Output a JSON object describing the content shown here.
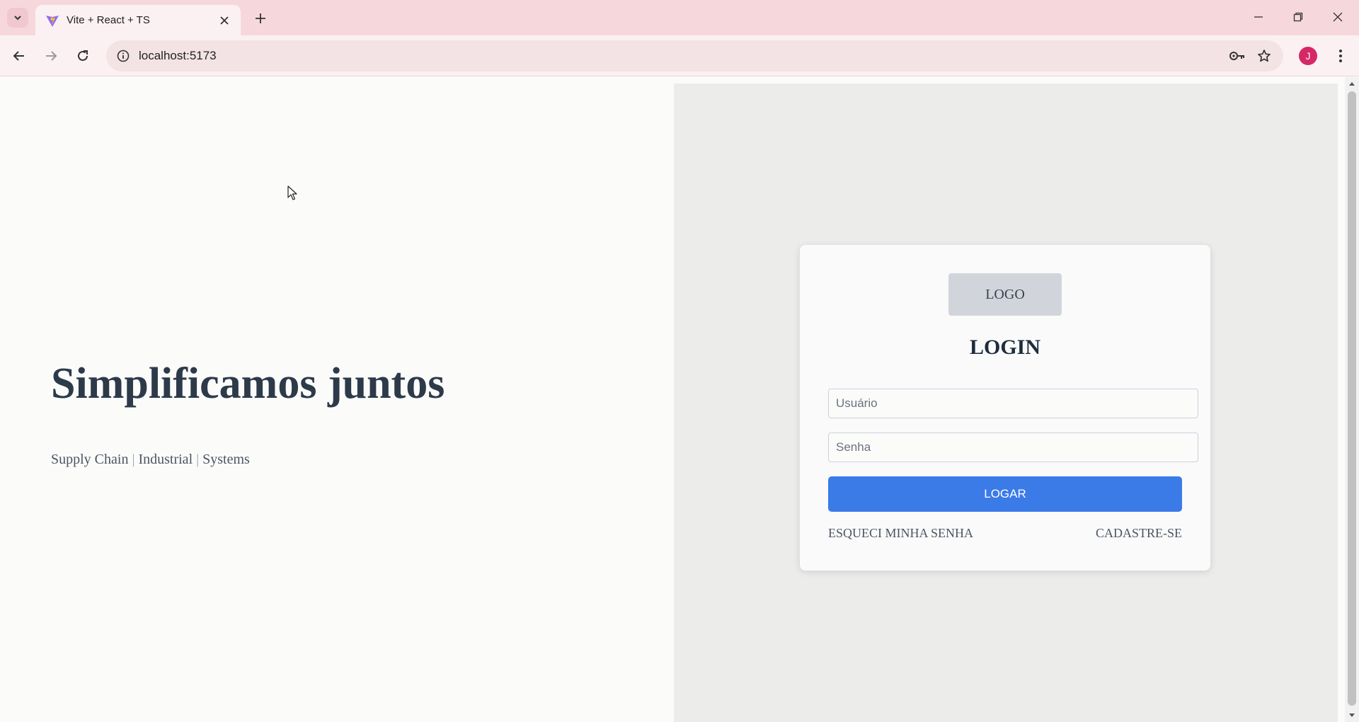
{
  "browser": {
    "tab_title": "Vite + React + TS",
    "url": "localhost:5173",
    "profile_initial": "J"
  },
  "hero": {
    "headline": "Simplificamos juntos",
    "tagline_parts": [
      "Supply Chain",
      "Industrial",
      "Systems"
    ],
    "separator": "|"
  },
  "login": {
    "logo_text": "LOGO",
    "title": "LOGIN",
    "username_placeholder": "Usuário",
    "password_placeholder": "Senha",
    "submit_label": "LOGAR",
    "forgot_label": "ESQUECI MINHA SENHA",
    "signup_label": "CADASTRE-SE"
  },
  "colors": {
    "primary": "#3b7be8",
    "heading": "#2d3a4a",
    "tab_strip": "#f6d8dc",
    "avatar": "#d62866"
  }
}
